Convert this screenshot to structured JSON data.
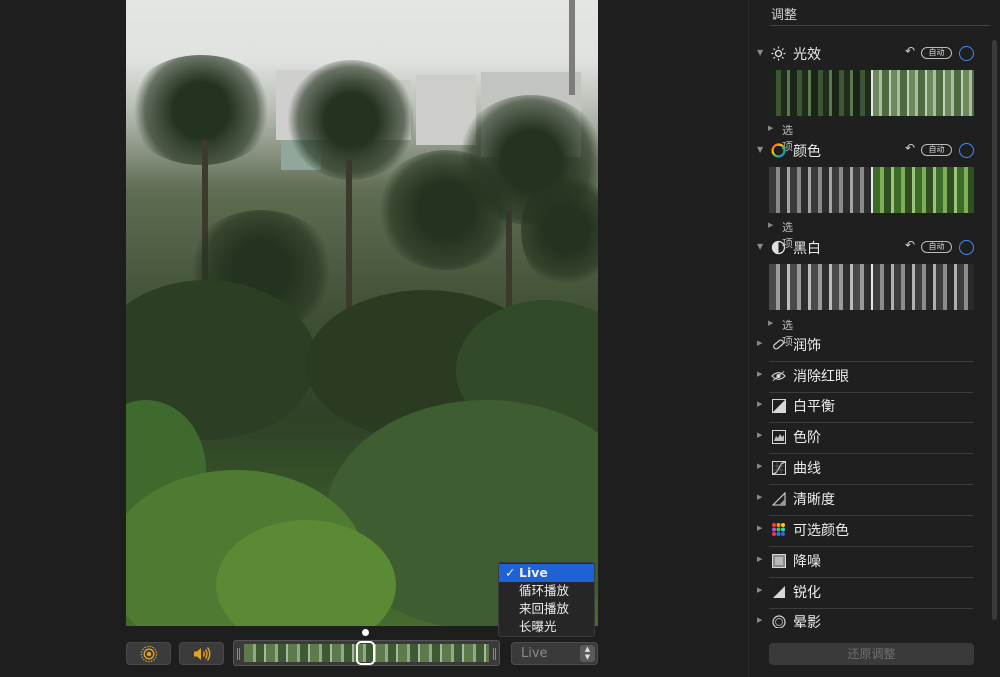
{
  "panel": {
    "title": "调整",
    "sections": [
      {
        "label": "光效",
        "icon": "sun-icon",
        "auto": "自动",
        "options": "选项"
      },
      {
        "label": "颜色",
        "icon": "color-wheel-icon",
        "auto": "自动",
        "options": "选项"
      },
      {
        "label": "黑白",
        "icon": "half-circle-icon",
        "auto": "自动",
        "options": "选项"
      }
    ],
    "rows": [
      {
        "label": "润饰",
        "icon": "bandage-icon"
      },
      {
        "label": "消除红眼",
        "icon": "eye-icon"
      },
      {
        "label": "白平衡",
        "icon": "white-balance-icon"
      },
      {
        "label": "色阶",
        "icon": "levels-icon"
      },
      {
        "label": "曲线",
        "icon": "curves-icon"
      },
      {
        "label": "清晰度",
        "icon": "definition-icon"
      },
      {
        "label": "可选颜色",
        "icon": "selective-color-icon"
      },
      {
        "label": "降噪",
        "icon": "noise-reduction-icon"
      },
      {
        "label": "锐化",
        "icon": "sharpen-icon"
      },
      {
        "label": "晕影",
        "icon": "vignette-icon"
      }
    ],
    "reset_label": "还原调整"
  },
  "controls": {
    "live_select_value": "Live",
    "menu": {
      "items": [
        "Live",
        "循环播放",
        "来回播放",
        "长曝光"
      ],
      "selected": "Live"
    }
  },
  "colors": {
    "accent": "#1d63d6",
    "toggle_ring": "#3d8ef5",
    "live_icon": "#e0a521"
  }
}
